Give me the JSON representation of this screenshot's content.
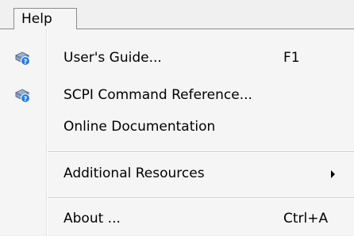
{
  "menu": {
    "title": "Help"
  },
  "items": [
    {
      "label": "User's Guide...",
      "shortcut": "F1",
      "icon": "help-book-icon"
    },
    {
      "label": "SCPI Command Reference...",
      "icon": "help-book-icon"
    },
    {
      "label": "Online Documentation"
    },
    {
      "label": "Additional Resources",
      "submenu": true
    },
    {
      "label": "About ...",
      "shortcut": "Ctrl+A"
    }
  ]
}
